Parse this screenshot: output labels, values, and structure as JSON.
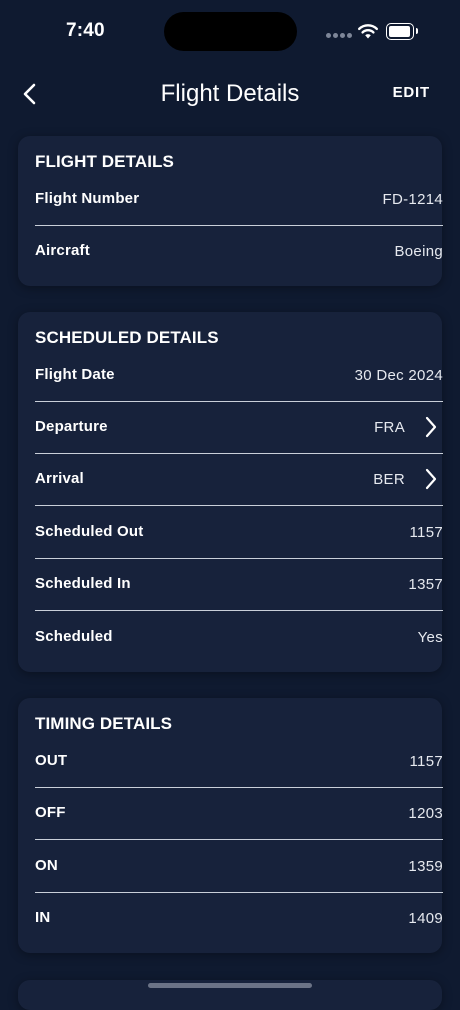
{
  "status_bar": {
    "time": "7:40"
  },
  "nav": {
    "title": "Flight Details",
    "edit_label": "EDIT"
  },
  "flight_details": {
    "title": "FLIGHT DETAILS",
    "rows": [
      {
        "label": "Flight Number",
        "value": "FD-1214"
      },
      {
        "label": "Aircraft",
        "value": "Boeing"
      }
    ]
  },
  "scheduled_details": {
    "title": "SCHEDULED DETAILS",
    "rows": [
      {
        "label": "Flight Date",
        "value": "30 Dec 2024"
      },
      {
        "label": "Departure",
        "value": "FRA"
      },
      {
        "label": "Arrival",
        "value": "BER"
      },
      {
        "label": "Scheduled Out",
        "value": "1157"
      },
      {
        "label": "Scheduled In",
        "value": "1357"
      },
      {
        "label": "Scheduled",
        "value": "Yes"
      }
    ]
  },
  "timing_details": {
    "title": "TIMING DETAILS",
    "rows": [
      {
        "label": "OUT",
        "value": "1157"
      },
      {
        "label": "OFF",
        "value": "1203"
      },
      {
        "label": "ON",
        "value": "1359"
      },
      {
        "label": "IN",
        "value": "1409"
      }
    ]
  },
  "icons": {
    "back": "chevron-left-icon",
    "row_nav": "chevron-right-icon",
    "wifi": "wifi-icon",
    "battery": "battery-icon"
  },
  "colors": {
    "background": "#0f1a30",
    "card": "#17223b",
    "text": "#ffffff",
    "divider": "#c9cfd9"
  }
}
